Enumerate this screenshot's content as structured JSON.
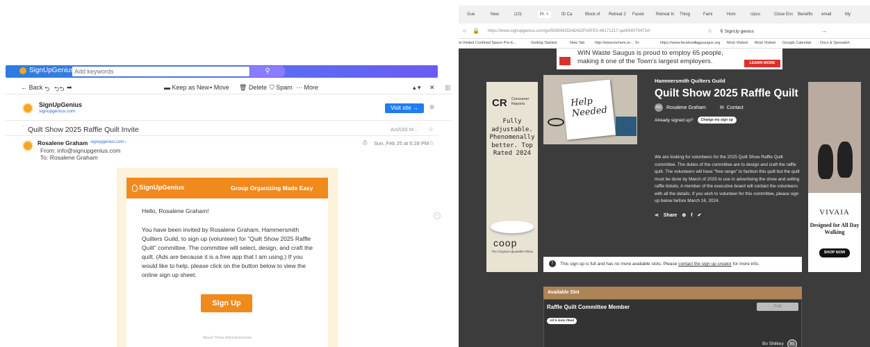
{
  "email": {
    "brand": "SignUpGenius",
    "search_placeholder": "Add keywords",
    "toolbar": {
      "back": "Back",
      "keep_as_new": "Keep as New",
      "move": "Move",
      "delete": "Delete",
      "spam": "Spam",
      "more": "More"
    },
    "sender_brand": "SignUpGenius",
    "sender_domain": "signupgenius.com",
    "visit_site": "Visit site →",
    "subject": "Quilt Show 2025 Raffle Quilt Invite",
    "folder": "Aol/Old M...",
    "from_name": "Rosalene Graham",
    "from_domain": "signupgenius.com",
    "from_line": "From: info@signupgenius.com",
    "to_line": "To: Rosalene Graham",
    "date": "Sun, Feb 25 at 5:28 PM",
    "card": {
      "logo": "SignUpGenius",
      "tagline": "Group Organizing Made Easy",
      "greeting": "Hello, Rosalene Graham!",
      "body": "You have been invited by Rosalene Graham, Hammersmith Quilters Guild, to sign up (volunteer) for \"Quilt Show 2025 Raffle Quilt\" committee. The committee will select, design, and craft the quilt. (Ads are because it is a free app that I am using.) If you would like to help, please click on the button below to view the online sign up sheet.",
      "button": "Sign Up",
      "ads_label": "About These Advertisements"
    }
  },
  "browser": {
    "tabs": [
      "Gue",
      "New",
      "(10)",
      "Pr. ×",
      "ID Ca",
      "Block of",
      "Retreat 2",
      "Faceb",
      "Retreat In",
      "Thing",
      "Fami",
      "Hom",
      "Upco",
      "Close Enc",
      "Benefits",
      "email",
      "My"
    ],
    "url": "https://www.signupgenius.com/go/5080942DABA62FA5FE3-48171217-quilt/54079473#/",
    "search_box": "SignUp genius",
    "bookmarks": [
      "st Visited",
      "Confined Space Pre-E...",
      "Getting Started",
      "New Tab",
      "http://www.inchem.or...",
      "9+",
      "https://www.facebook...",
      "hqgsaugus.org",
      "Most Visited",
      "Most Visited",
      "Google Calendar",
      "Docs & Spreadsh"
    ],
    "banner_line1": "WIN Waste Saugus is proud to employ 65 people,",
    "banner_line2": "making it one of the Town's largest employers.",
    "banner_cta": "LEARN MORE",
    "ad_left": {
      "brand": "CR",
      "brand_sub": "Consumer Reports",
      "text": "Fully adjustable. Phenomenally better. Top Rated 2024",
      "product": "coop",
      "product_sub": "The Original Adjustable Pillow"
    },
    "ad_right": {
      "brand": "VIVAIA",
      "text": "Designed for All Day Walking",
      "cta": "SHOP NOW"
    },
    "hero_text": "Help Needed",
    "guild": "Hammersmith Quilters Guild",
    "title": "Quilt Show 2025 Raffle Quilt",
    "organizer_initials": "RG",
    "organizer": "Rosalene Graham",
    "contact": "Contact",
    "already_signed": "Already signed up?",
    "change_btn": "Change my sign up",
    "description": "We are looking for volunteers for the 2025 Quilt Show Raffle Quilt committee.  The duties of the committee are to design and craft the raffle quilt.  The volunteers will have \"free range\" to fashion this quilt but the quilt must be done by March of 2025 to use in advertising the show and selling raffle tickets.  A member of the executive board will contact the volunteers with all the details.  If you wish to volunteer for this committee, please sign up below before March 16, 2024.",
    "share": "Share",
    "full_note_pre": "This sign up is full and has no more available slots. Please",
    "full_note_link": "contact the sign up creator",
    "full_note_post": "for more info.",
    "slot_header": "Available Slot",
    "slot_name": "Raffle Quilt Committee Member",
    "slot_status": "Full",
    "slot_filled": "All 5 slots filled",
    "volunteer": "Bo Shilkey",
    "volunteer_initials": "BS"
  }
}
